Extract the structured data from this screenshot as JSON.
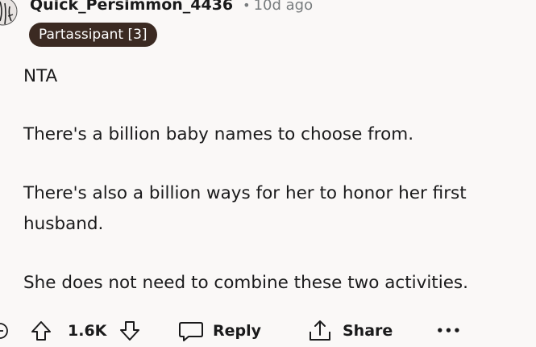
{
  "comment": {
    "author": "Quick_Persimmon_4436",
    "separator": "•",
    "age": "10d ago",
    "flair": "Partassipant [3]",
    "paragraphs": [
      "NTA",
      "There's a billion baby names to choose from.",
      "There's also a billion ways for her to honor her first husband.",
      "She does not need to combine these two activities."
    ]
  },
  "actions": {
    "vote_count": "1.6K",
    "reply_label": "Reply",
    "share_label": "Share",
    "more_label": "•••"
  },
  "colors": {
    "background": "#faf8f7",
    "text": "#1a1a1b",
    "meta": "#787c7e",
    "flair_bg": "#3b2a22",
    "flair_text": "#ffffff"
  },
  "icons": [
    "avatar-icon",
    "upvote-icon",
    "downvote-icon",
    "reply-icon",
    "share-icon",
    "more-icon",
    "award-icon"
  ]
}
